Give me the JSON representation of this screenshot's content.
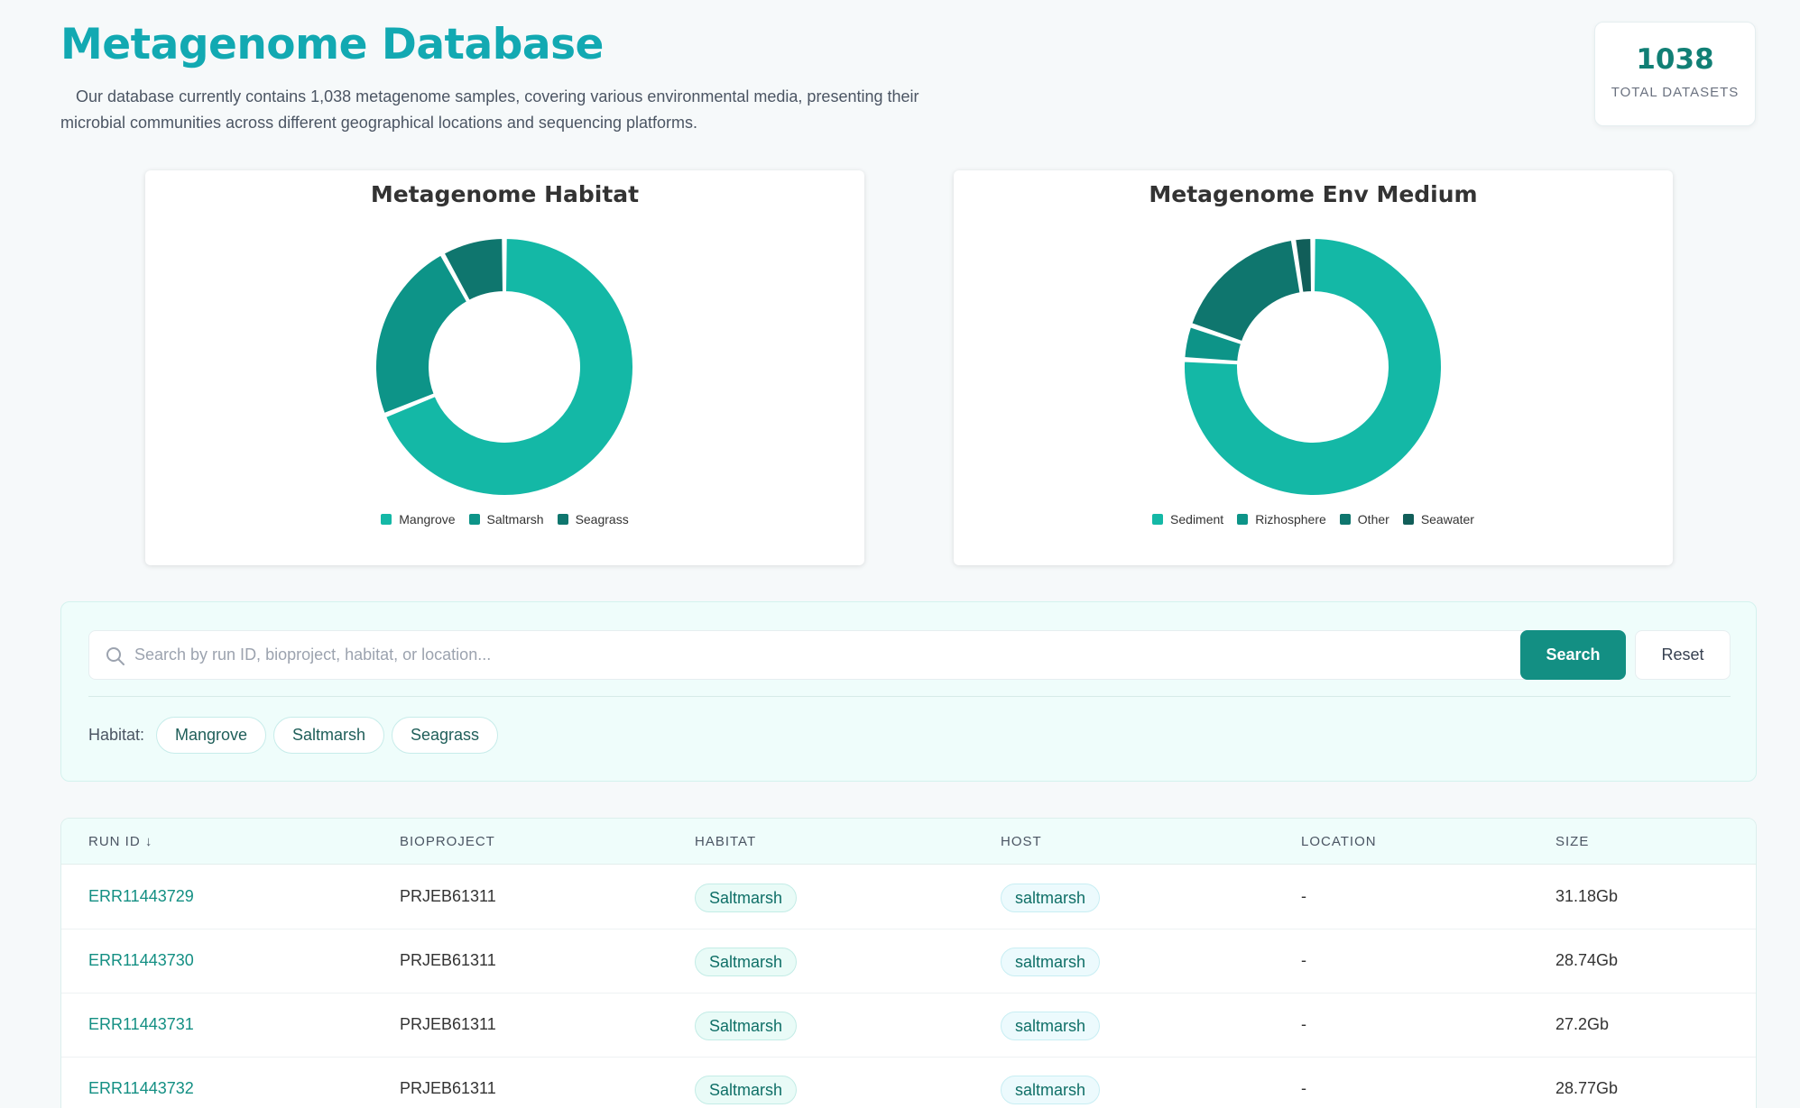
{
  "header": {
    "title": "Metagenome Database",
    "intro": "Our database currently contains 1,038 metagenome samples, covering various environmental media, presenting their microbial communities across different geographical locations and sequencing platforms."
  },
  "stats": {
    "total_value": "1038",
    "total_label": "TOTAL DATASETS"
  },
  "chart_data": [
    {
      "type": "pie",
      "title": "Metagenome Habitat",
      "categories": [
        "Mangrove",
        "Saltmarsh",
        "Seagrass"
      ],
      "values": [
        715,
        240,
        83
      ],
      "colors": [
        "#14b8a6",
        "#0d9488",
        "#0f766e"
      ],
      "donut": true,
      "legend": "bottom"
    },
    {
      "type": "pie",
      "title": "Metagenome Env Medium",
      "categories": [
        "Sediment",
        "Rizhosphere",
        "Other",
        "Seawater"
      ],
      "values": [
        788,
        45,
        180,
        25
      ],
      "colors": [
        "#14b8a6",
        "#0d9488",
        "#0f766e",
        "#115e59"
      ],
      "donut": true,
      "legend": "bottom"
    }
  ],
  "search": {
    "placeholder": "Search by run ID, bioproject, habitat, or location...",
    "search_label": "Search",
    "reset_label": "Reset",
    "filter_label": "Habitat:",
    "chips": [
      "Mangrove",
      "Saltmarsh",
      "Seagrass"
    ]
  },
  "table": {
    "headers": [
      "RUN ID ↓",
      "BIOPROJECT",
      "HABITAT",
      "HOST",
      "LOCATION",
      "SIZE"
    ],
    "rows": [
      {
        "run_id": "ERR11443729",
        "bioproject": "PRJEB61311",
        "habitat": "Saltmarsh",
        "host": "saltmarsh",
        "location": "-",
        "size": "31.18Gb"
      },
      {
        "run_id": "ERR11443730",
        "bioproject": "PRJEB61311",
        "habitat": "Saltmarsh",
        "host": "saltmarsh",
        "location": "-",
        "size": "28.74Gb"
      },
      {
        "run_id": "ERR11443731",
        "bioproject": "PRJEB61311",
        "habitat": "Saltmarsh",
        "host": "saltmarsh",
        "location": "-",
        "size": "27.2Gb"
      },
      {
        "run_id": "ERR11443732",
        "bioproject": "PRJEB61311",
        "habitat": "Saltmarsh",
        "host": "saltmarsh",
        "location": "-",
        "size": "28.77Gb"
      }
    ]
  }
}
